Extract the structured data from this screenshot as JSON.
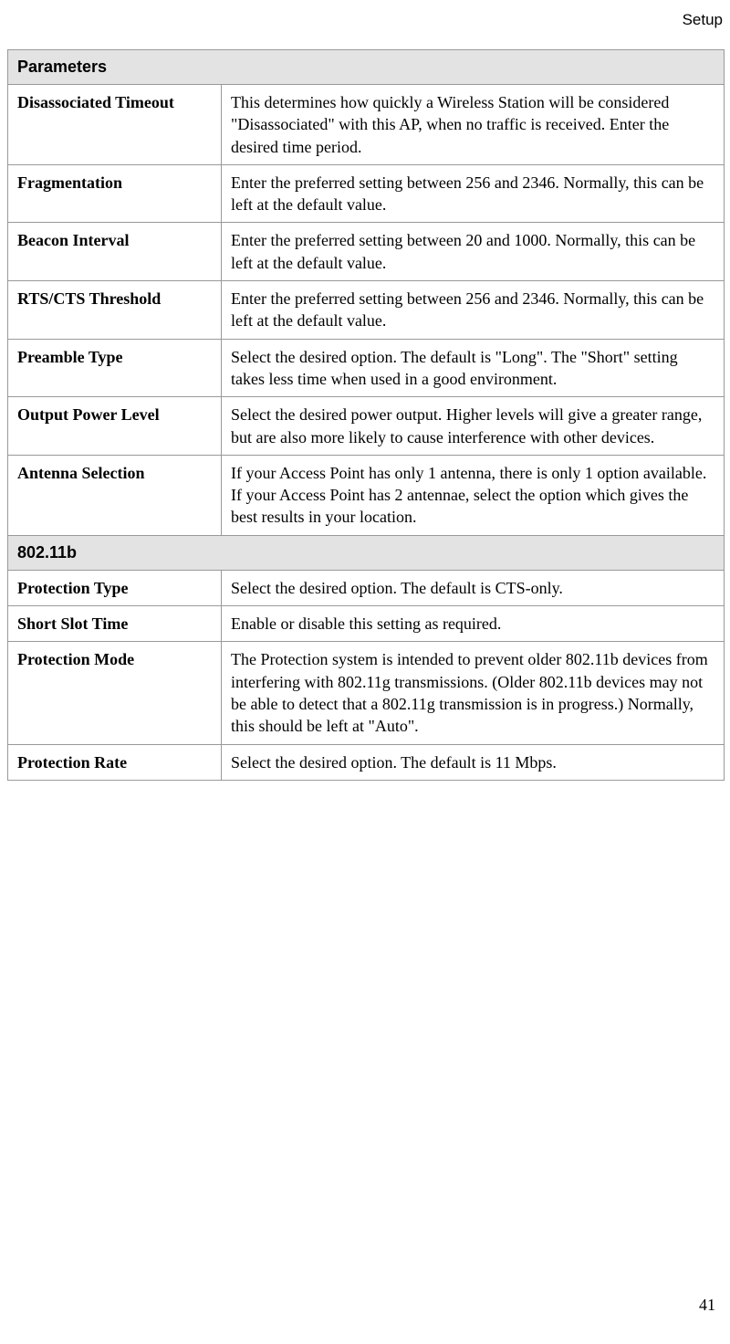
{
  "header": {
    "section": "Setup"
  },
  "table": {
    "section1": "Parameters",
    "rows1": [
      {
        "name": "Disassociated Timeout",
        "desc": "This determines how quickly a Wireless Station will be considered \"Disassociated\" with this AP, when no traffic is received. Enter the desired time period."
      },
      {
        "name": "Fragmentation",
        "desc": "Enter the preferred setting between 256 and 2346. Normally, this can be left at the default value."
      },
      {
        "name": "Beacon Interval",
        "desc": "Enter the preferred setting between 20 and 1000. Normally, this can be left at the default value."
      },
      {
        "name": "RTS/CTS Threshold",
        "desc": "Enter the preferred setting between 256 and 2346. Normally, this can be left at the default value."
      },
      {
        "name": "Preamble Type",
        "desc": "Select the desired option. The default is \"Long\". The \"Short\" setting takes less time when used in a good environment."
      },
      {
        "name": "Output Power Level",
        "desc": "Select the desired power output. Higher levels will give a greater range, but are also more likely to cause interference with other devices."
      },
      {
        "name": "Antenna Selection",
        "desc": "If your Access Point has only 1 antenna, there is only 1 option available. If your Access Point has 2 antennae, select the option which gives the best results in your location."
      }
    ],
    "section2": "802.11b",
    "rows2": [
      {
        "name": "Protection Type",
        "desc": "Select the desired option. The default is CTS-only."
      },
      {
        "name": "Short Slot Time",
        "desc": "Enable or disable this setting as required."
      },
      {
        "name": "Protection Mode",
        "desc": "The Protection system is intended to prevent older 802.11b devices from interfering with 802.11g transmissions. (Older 802.11b devices may not be able to detect that a 802.11g transmission is in progress.) Normally, this should be left at \"Auto\"."
      },
      {
        "name": "Protection Rate",
        "desc": "Select the desired option. The default is 11 Mbps."
      }
    ]
  },
  "page_number": "41"
}
